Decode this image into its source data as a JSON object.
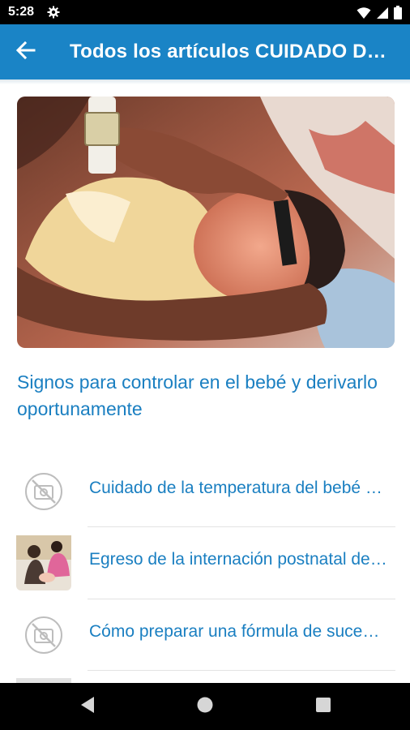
{
  "status_bar": {
    "time": "5:28",
    "icons": [
      "settings-icon",
      "wifi-icon",
      "signal-icon",
      "battery-icon"
    ]
  },
  "app_bar": {
    "title": "Todos los artículos CUIDADO DEL BEBÉ",
    "back_icon": "arrow-back-icon",
    "color": "#1a84c6"
  },
  "featured_article": {
    "title": "Signos para controlar en el bebé y derivarlo oportunamente"
  },
  "articles": [
    {
      "title": "Cuidado de la temperatura del bebé en casa",
      "thumbnail": "no-image-icon"
    },
    {
      "title": "Egreso de la internación postnatal del bebé",
      "thumbnail": "photo"
    },
    {
      "title": "Cómo preparar una fórmula de sucedáneo",
      "thumbnail": "no-image-icon"
    }
  ],
  "nav_bar": {
    "icons": [
      "back-triangle-icon",
      "home-circle-icon",
      "recents-square-icon"
    ]
  },
  "colors": {
    "accent": "#1a7fc1",
    "status_bar": "#000000",
    "divider": "#e3e3e3"
  }
}
